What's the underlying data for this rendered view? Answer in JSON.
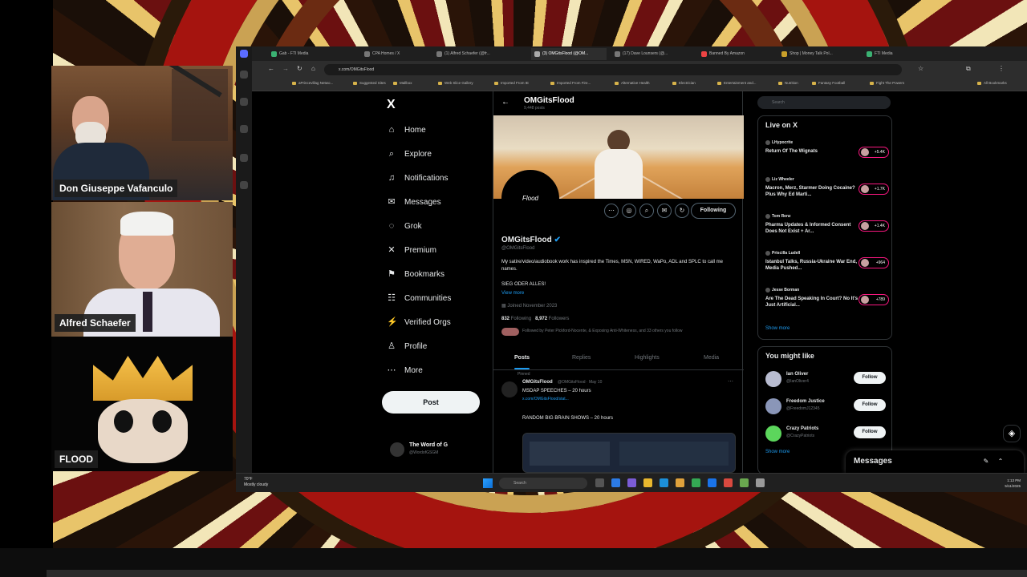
{
  "participants": [
    {
      "name": "Don Giuseppe Vafanculo"
    },
    {
      "name": "Alfred Schaefer"
    },
    {
      "name": "FLOOD"
    }
  ],
  "browser": {
    "tabs": [
      "Gab - FTI Media",
      "CPA Homes / X",
      "(1) Alfred Schaefer (@fr...",
      "(3) OMGitsFlood (@OM...",
      "(17) Dave Lounsers (@...",
      "Banned By Amazon",
      "Shop | Money Talk Pol...",
      "FTI Media"
    ],
    "url": "x.com/OMGitsFlood",
    "bookmarks": [
      "aPrincevillag Netwo...",
      "Suggested Sites",
      "Mallbox",
      "Web Slice Gallery",
      "Imported From IE",
      "Imported From Fire...",
      "Alternative Health",
      "Electrician",
      "Entertainment and...",
      "Nutrition",
      "Fantasy Football",
      "Fight The Powers",
      "All Bookmarks"
    ]
  },
  "nav": {
    "logo": "X",
    "items": [
      {
        "label": "Home",
        "icon": "home-icon",
        "glyph": "⌂"
      },
      {
        "label": "Explore",
        "icon": "search-icon",
        "glyph": "⌕"
      },
      {
        "label": "Notifications",
        "icon": "bell-icon",
        "glyph": "♫"
      },
      {
        "label": "Messages",
        "icon": "envelope-icon",
        "glyph": "✉"
      },
      {
        "label": "Grok",
        "icon": "grok-icon",
        "glyph": "◌"
      },
      {
        "label": "Premium",
        "icon": "x-premium-icon",
        "glyph": "✕"
      },
      {
        "label": "Bookmarks",
        "icon": "bookmark-icon",
        "glyph": "⚑"
      },
      {
        "label": "Communities",
        "icon": "people-icon",
        "glyph": "☷"
      },
      {
        "label": "Verified Orgs",
        "icon": "verified-orgs-icon",
        "glyph": "⚡"
      },
      {
        "label": "Profile",
        "icon": "person-icon",
        "glyph": "♙"
      },
      {
        "label": "More",
        "icon": "more-icon",
        "glyph": "⋯"
      }
    ],
    "post_label": "Post",
    "account": {
      "name": "The Word of G",
      "handle": "@WordofGSGM"
    }
  },
  "profile": {
    "header_name": "OMGitsFlood",
    "header_sub": "9,448 posts",
    "display_name": "OMGitsFlood",
    "handle": "@OMGitsFlood",
    "bio": "My satire/video/audiobook work has inspired the Times, MSN, WIRED, WaPo, ADL and SPLC to call me names.",
    "bio_line2": "SIEG ODER ALLES!",
    "view_more": "View more",
    "joined": "Joined November 2023",
    "following_count": "832",
    "following_label": "Following",
    "followers_count": "8,972",
    "followers_label": "Followers",
    "followed_by": "Followed by Peter Pickford-Nocente, & Exposing Anti-Whiteness, and 33 others you follow",
    "following_button": "Following",
    "avatar_text": "Flood",
    "tabs": [
      "Posts",
      "Replies",
      "Highlights",
      "Media"
    ]
  },
  "tweet": {
    "pinned": "Pinned",
    "name": "OMGitsFlood",
    "meta": "@OMGitsFlood · May 10",
    "line1": "MSDAP SPEECHES – 20 hours",
    "link": "x.com/OMGitsFlood/stat...",
    "line3": "RANDOM BIG BRAIN SHOWS – 20 hours"
  },
  "aside": {
    "search_placeholder": "Search",
    "live_title": "Live on X",
    "live": [
      {
        "host": "LHypocrite",
        "title": "Return Of The Wignats",
        "count": "+5.4K"
      },
      {
        "host": "Liz Wheeler",
        "title": "Macron, Merz, Starmer Doing Cocaine? Plus Why Ed Marti...",
        "count": "+1.7K"
      },
      {
        "host": "Tom Renz",
        "title": "Pharma Updates & Informed Consent Does Not Exist + Ar...",
        "count": "+1.4K"
      },
      {
        "host": "Priscilla Ludell",
        "title": "Istanbul Talks, Russia-Ukraine War End, Media Pushed...",
        "count": "+964"
      },
      {
        "host": "Jesse Borman",
        "title": "Are The Dead Speaking In Court? No It's Just Artificial...",
        "count": "+789"
      }
    ],
    "show_more": "Show more",
    "wtf_title": "You might like",
    "wtf": [
      {
        "name": "Ian Oliver",
        "handle": "@IanOliver4"
      },
      {
        "name": "Freedom Justice",
        "handle": "@FreedomJ12345"
      },
      {
        "name": "Crazy Patriots",
        "handle": "@CrazyPatriots"
      }
    ],
    "follow_label": "Follow",
    "wtf_show_more": "Show more"
  },
  "messages": {
    "title": "Messages"
  },
  "taskbar": {
    "weather_temp": "70°F",
    "weather_desc": "Mostly cloudy",
    "search_placeholder": "Search",
    "time": "1:13 PM",
    "date": "5/11/2025"
  },
  "colors": {
    "accent": "#1d9bf0",
    "live": "#f91880",
    "background": "#000000"
  }
}
